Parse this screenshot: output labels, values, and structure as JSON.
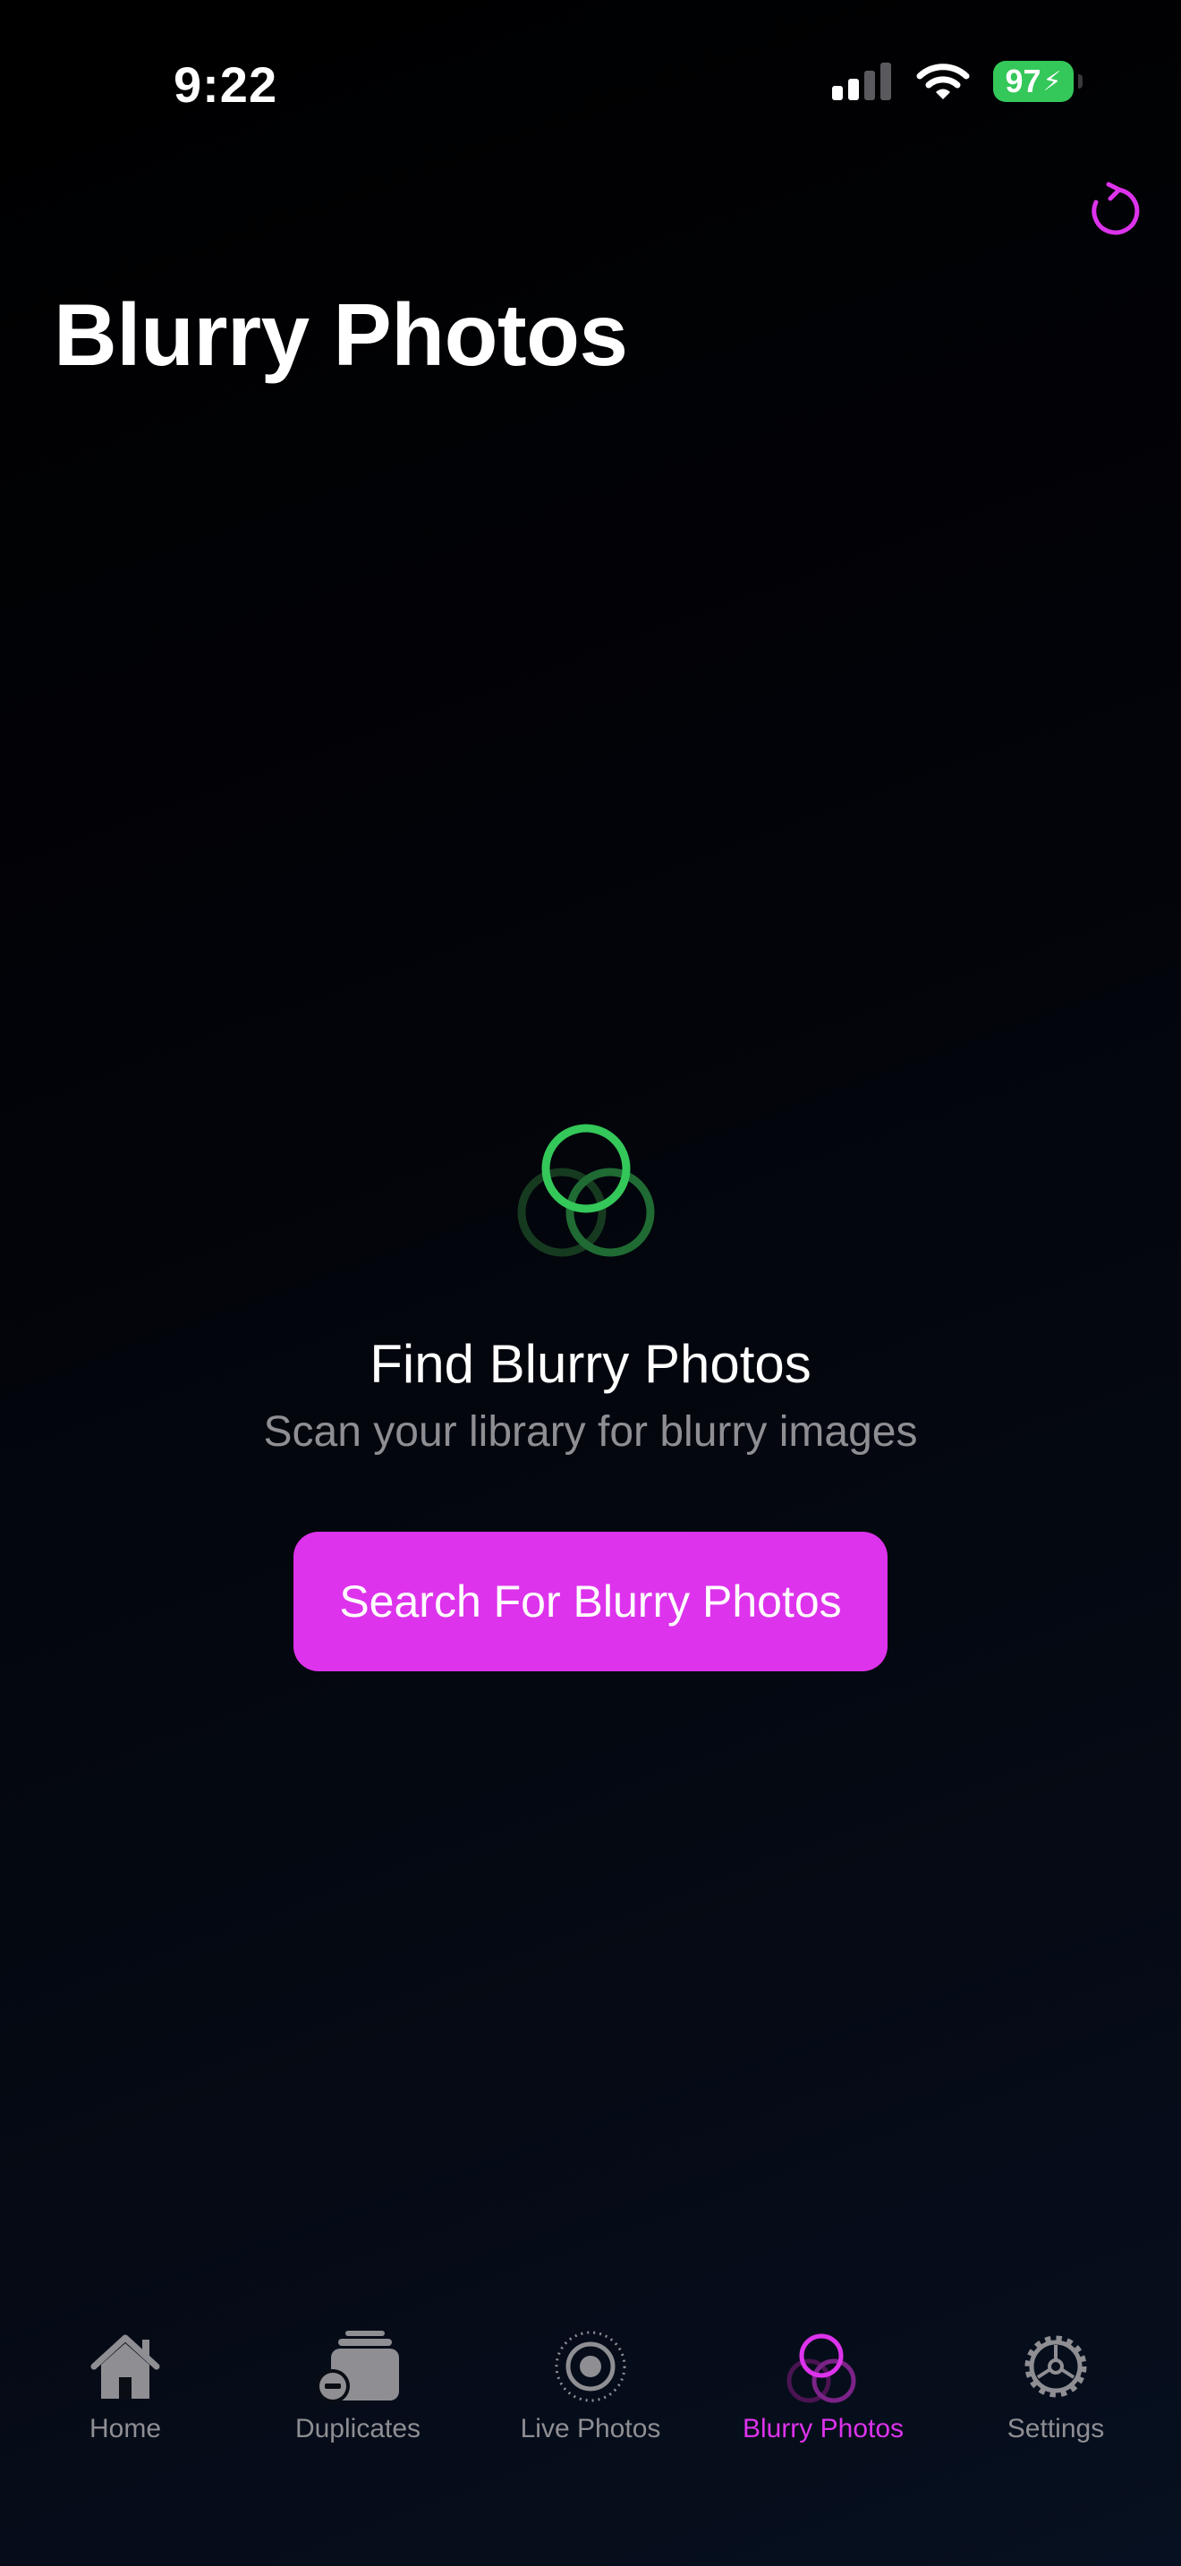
{
  "status_bar": {
    "time": "9:22",
    "battery": "97"
  },
  "header": {
    "title": "Blurry Photos",
    "refresh_icon": "refresh-icon"
  },
  "empty_state": {
    "icon": "blurry-circles-icon",
    "heading": "Find Blurry Photos",
    "subtitle": "Scan your library for blurry images",
    "button_label": "Search For Blurry Photos"
  },
  "tabs": [
    {
      "label": "Home",
      "icon": "home-icon",
      "active": false
    },
    {
      "label": "Duplicates",
      "icon": "duplicates-icon",
      "active": false
    },
    {
      "label": "Live Photos",
      "icon": "live-photos-icon",
      "active": false
    },
    {
      "label": "Blurry Photos",
      "icon": "blurry-photos-icon",
      "active": true
    },
    {
      "label": "Settings",
      "icon": "gear-icon",
      "active": false
    }
  ],
  "colors": {
    "accent": "#dd33ec",
    "green": "#34c759",
    "inactive": "#8e8e93"
  }
}
